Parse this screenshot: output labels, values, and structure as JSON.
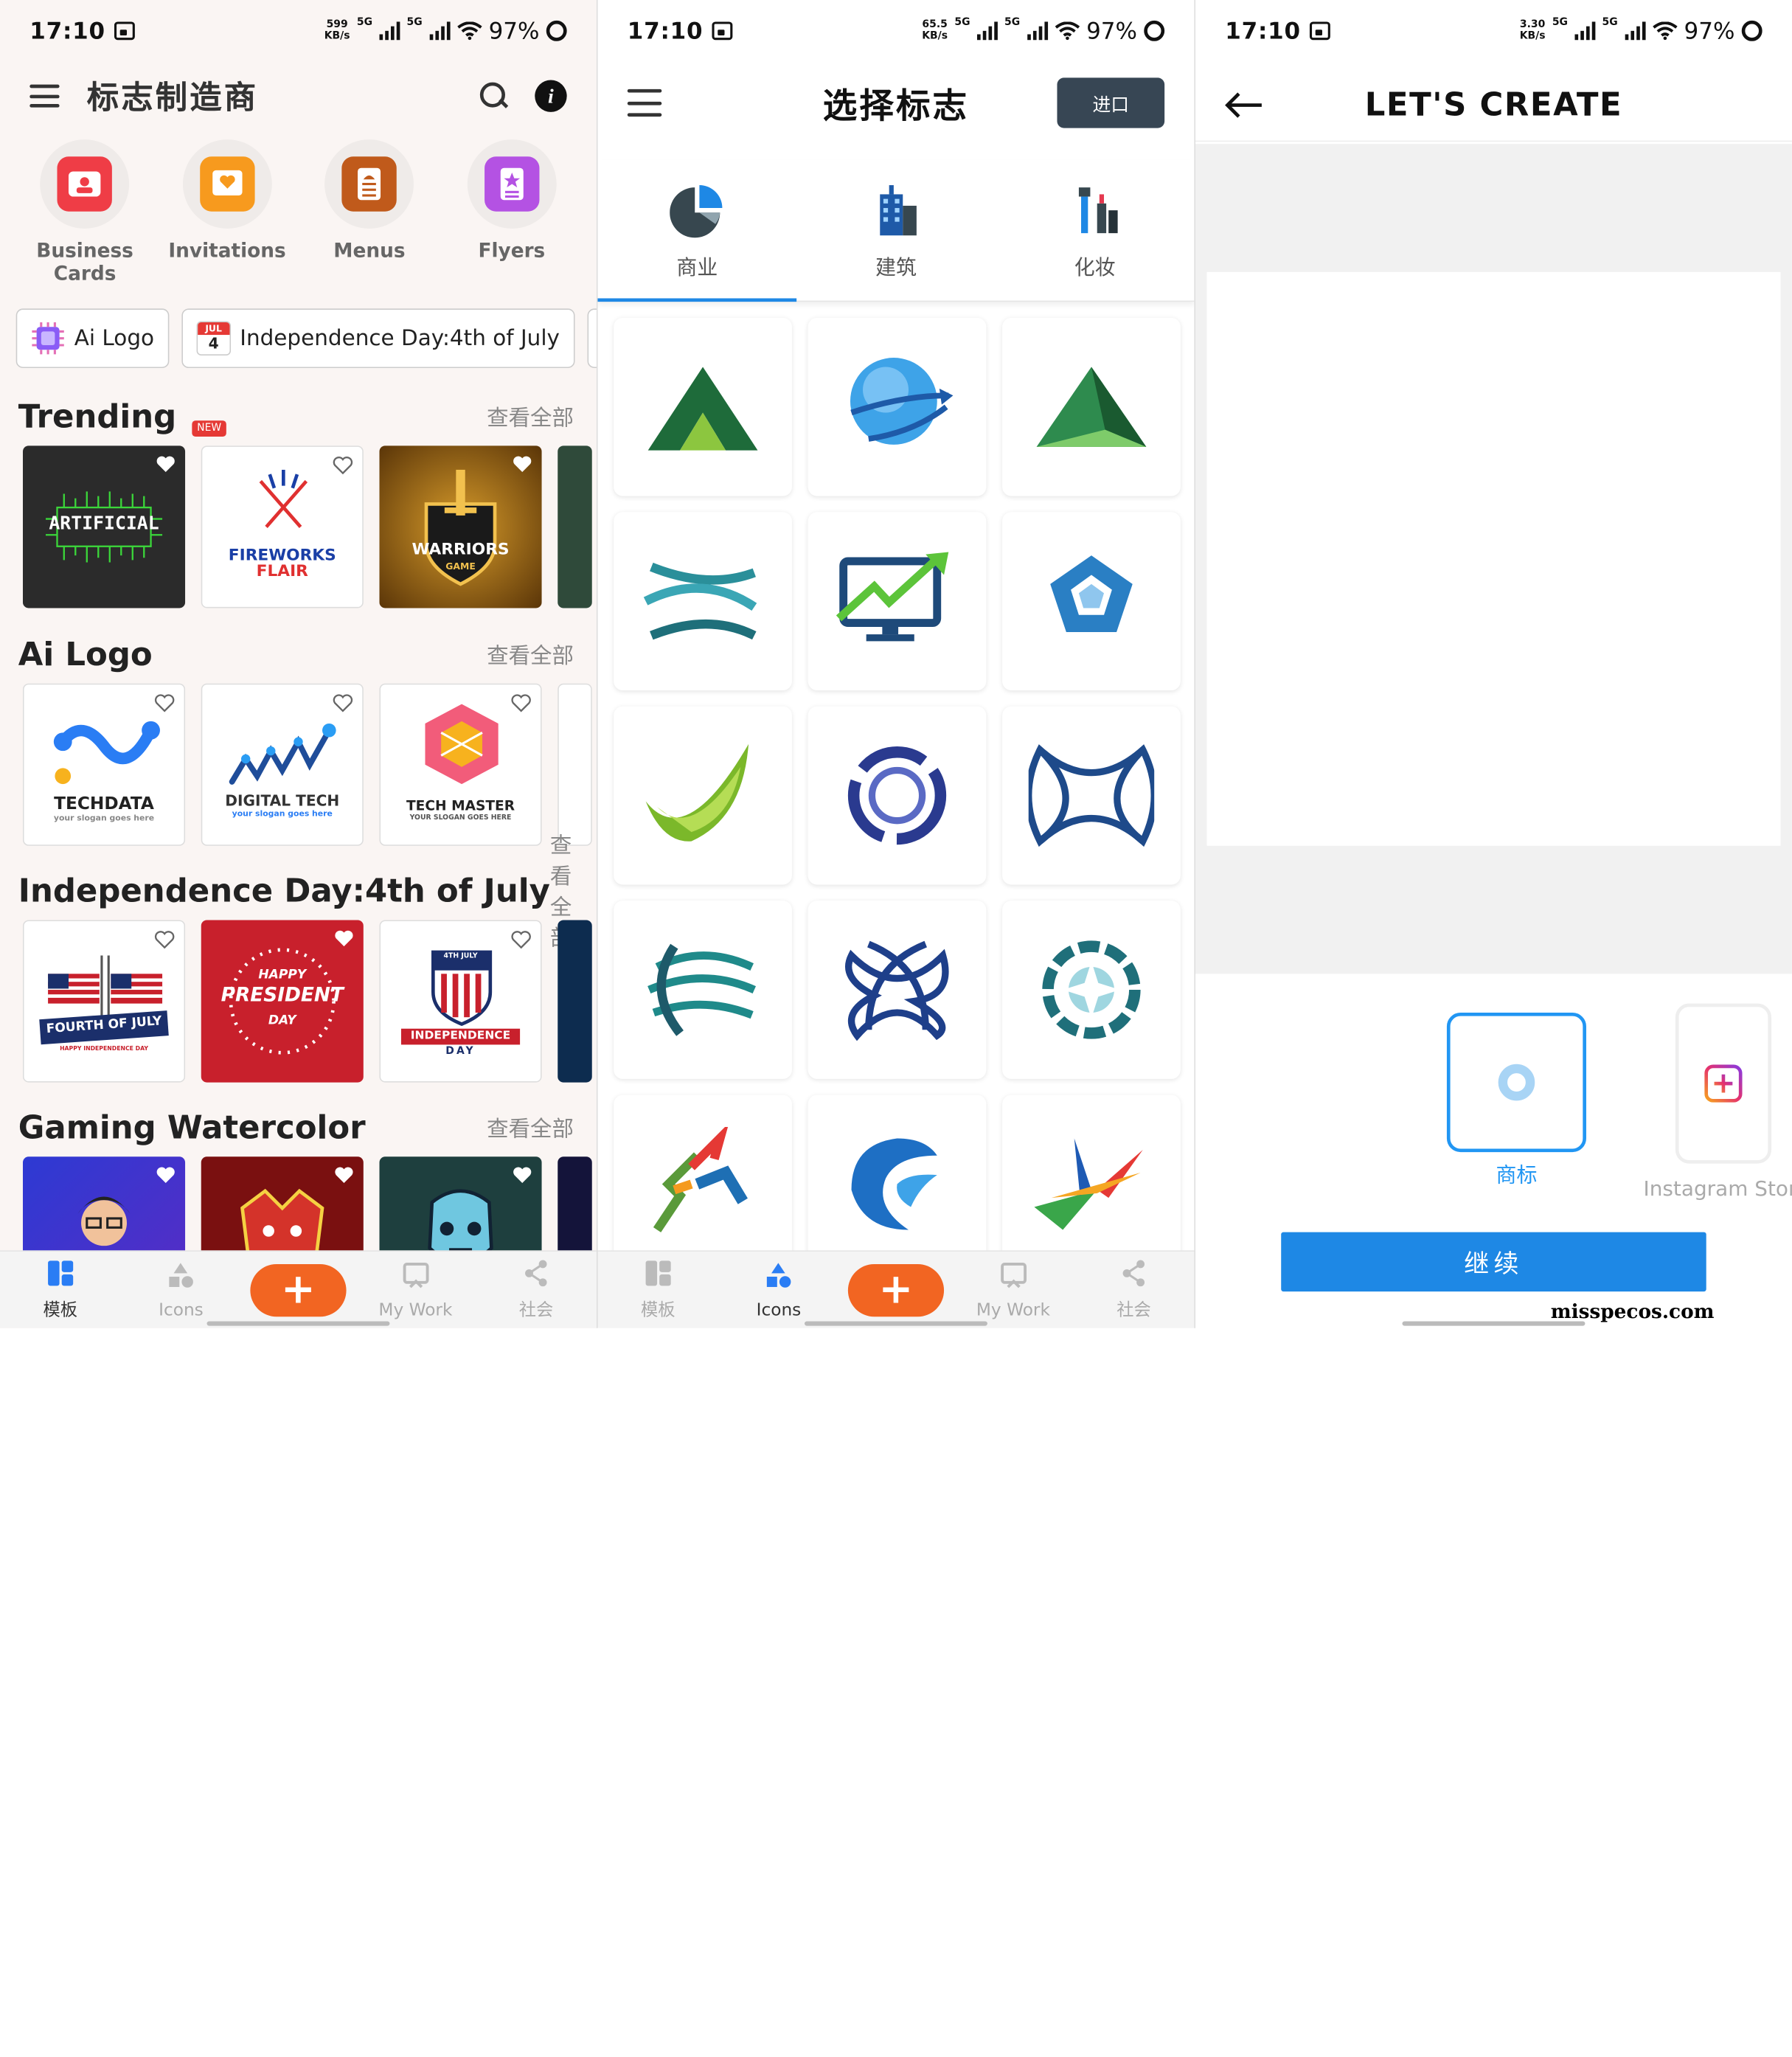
{
  "status": [
    {
      "time": "17:10",
      "speed": "599",
      "speed_unit": "KB/s",
      "net1": "5G",
      "net2": "5G",
      "battery": "97%"
    },
    {
      "time": "17:10",
      "speed": "65.5",
      "speed_unit": "KB/s",
      "net1": "5G",
      "net2": "5G",
      "battery": "97%"
    },
    {
      "time": "17:10",
      "speed": "3.30",
      "speed_unit": "KB/s",
      "net1": "5G",
      "net2": "5G",
      "battery": "97%"
    }
  ],
  "home": {
    "title": "标志制造商",
    "categories": [
      {
        "label": "Business Cards",
        "icon": "business-card-icon",
        "color": "#ef3d46"
      },
      {
        "label": "Invitations",
        "icon": "invitation-icon",
        "color": "#f79a1e"
      },
      {
        "label": "Menus",
        "icon": "menu-icon",
        "color": "#c05a1b"
      },
      {
        "label": "Flyers",
        "icon": "flyer-icon",
        "color": "#b452e3"
      }
    ],
    "chips": [
      {
        "label": "Ai Logo",
        "icon": "ai-chip-icon"
      },
      {
        "label": "Independence Day:4th of July",
        "icon": "calendar-icon",
        "cal_month": "JUL",
        "cal_day": "4"
      }
    ],
    "see_all": "查看全部",
    "sections": [
      {
        "title": "Trending",
        "badge": "NEW",
        "items": [
          {
            "text": "ARTIFICIAL",
            "bg": "#2b2b2b",
            "fg": "#3bd63a"
          },
          {
            "text": "FIREWORKS",
            "text2": "FLAIR",
            "bg": "#ffffff",
            "fg": "#1a3fa6"
          },
          {
            "text": "WARRIORS",
            "text2": "GAME",
            "bg": "#8a5a10",
            "fg": "#ffffff"
          }
        ]
      },
      {
        "title": "Ai Logo",
        "items": [
          {
            "text": "TECHDATA",
            "text2": "your slogan goes here",
            "bg": "#ffffff",
            "fg": "#222"
          },
          {
            "text": "DIGITAL TECH",
            "text2": "your slogan goes here",
            "bg": "#ffffff",
            "fg": "#333"
          },
          {
            "text": "TECH MASTER",
            "text2": "YOUR SLOGAN GOES HERE",
            "bg": "#ffffff",
            "fg": "#222"
          }
        ]
      },
      {
        "title": "Independence Day:4th of July",
        "items": [
          {
            "text": "FOURTH OF JULY",
            "text2": "HAPPY INDEPENDENCE DAY",
            "bg": "#ffffff",
            "fg": "#1b2f6b"
          },
          {
            "text": "HAPPY",
            "text2": "PRESIDENT",
            "text3": "DAY",
            "bg": "#c8202c",
            "fg": "#ffffff"
          },
          {
            "text": "INDEPENDENCE",
            "text2": "DAY",
            "text3": "4TH JULY",
            "bg": "#ffffff",
            "fg": "#c8202c"
          }
        ]
      },
      {
        "title": "Gaming Watercolor",
        "items": [
          {
            "bg": "#3a2fc7"
          },
          {
            "bg": "#7a1010"
          },
          {
            "bg": "#1e3f3e"
          }
        ]
      }
    ],
    "tabs": [
      "模板",
      "Icons",
      "My Work",
      "社会"
    ]
  },
  "picker": {
    "title": "选择标志",
    "import_label": "进口",
    "tabs": [
      {
        "label": "商业",
        "icon": "pie-chart-icon"
      },
      {
        "label": "建筑",
        "icon": "building-icon"
      },
      {
        "label": "化妆",
        "icon": "cosmetics-icon"
      }
    ],
    "logos": [
      "mountain-logo",
      "globe-arrows-logo",
      "pyramid-logo",
      "ribbon-swirl-logo",
      "monitor-growth-logo",
      "pentagon-logo",
      "green-swoosh-logo",
      "ring-swirl-logo",
      "infinity-knot-logo",
      "globe-stripes-logo",
      "knot-loops-logo",
      "star-ring-logo",
      "zigzag-logo",
      "wave-circle-logo",
      "star-burst-logo"
    ],
    "tabs_bottom": [
      "模板",
      "Icons",
      "My Work",
      "社会"
    ]
  },
  "create": {
    "title": "LET'S CREATE",
    "options": [
      {
        "label": "商标",
        "icon": "logo-ring-icon"
      },
      {
        "label": "Instagram Story",
        "icon": "add-square-icon"
      }
    ],
    "continue_label": "继续",
    "watermark": "misspecos.com"
  },
  "colors": {
    "accent": "#1e88e5",
    "fab": "#f26522",
    "import_bg": "#374654"
  }
}
